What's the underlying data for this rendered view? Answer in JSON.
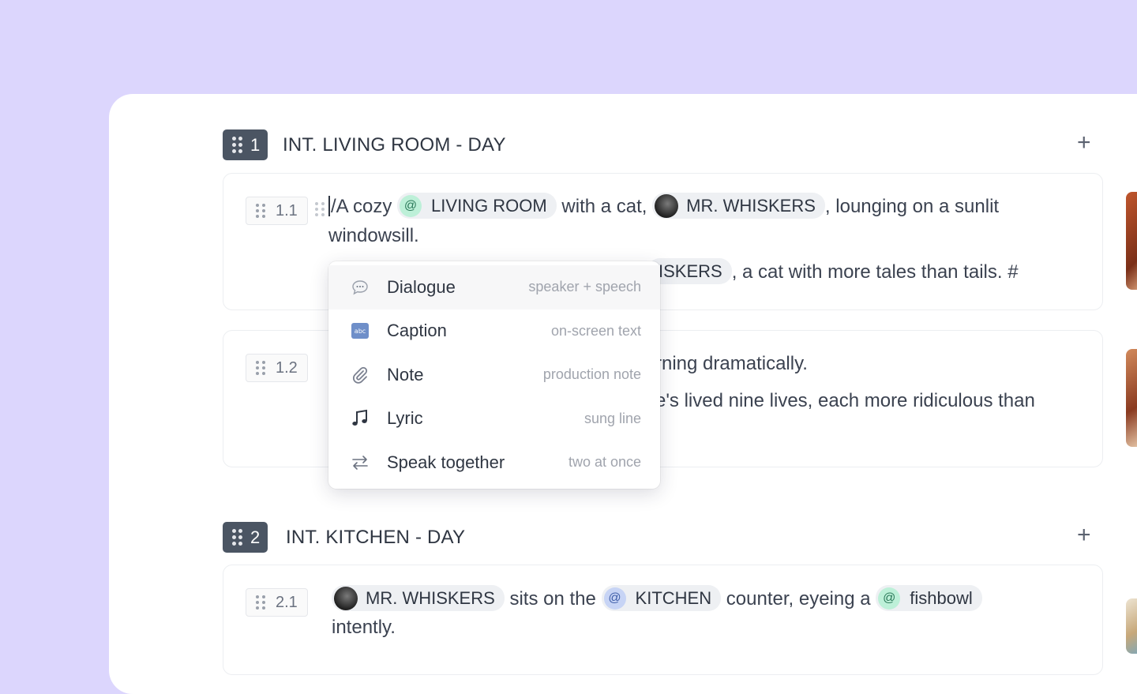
{
  "colors": {
    "background": "#dcd6fd",
    "card": "#ffffff",
    "badge": "#4b5563",
    "location_chip": "#bdf0d8",
    "prop_chip": "#c7d4f5"
  },
  "scenes": [
    {
      "number": "1",
      "title": "INT. LIVING ROOM - DAY",
      "add_icon": "+",
      "shots": [
        {
          "number": "1.1",
          "line1": {
            "slash": "/",
            "t1": "A cozy",
            "chip1": "LIVING ROOM",
            "t2": "with a cat,",
            "chip2": "MR. WHISKERS",
            "t3": ", lounging on a sunlit"
          },
          "line2": "windowsill.",
          "line3": {
            "chip_tail": "ISKERS",
            "t": ", a cat with more tales than tails. #"
          }
        },
        {
          "number": "1.2",
          "line1": "rning dramatically.",
          "line2": "e's lived nine lives, each more ridiculous than"
        }
      ]
    },
    {
      "number": "2",
      "title": "INT. KITCHEN - DAY",
      "add_icon": "+",
      "shots": [
        {
          "number": "2.1",
          "line1": {
            "chip1": "MR. WHISKERS",
            "t1": "sits on the",
            "chip2": "KITCHEN",
            "t2": "counter, eyeing a",
            "chip3": "fishbowl"
          },
          "line2": "intently."
        }
      ]
    }
  ],
  "menu": [
    {
      "icon": "speech-bubble-icon",
      "label": "Dialogue",
      "hint": "speaker + speech"
    },
    {
      "icon": "abc-icon",
      "label": "Caption",
      "hint": "on-screen text"
    },
    {
      "icon": "paperclip-icon",
      "label": "Note",
      "hint": "production note"
    },
    {
      "icon": "music-note-icon",
      "label": "Lyric",
      "hint": "sung line"
    },
    {
      "icon": "swap-arrows-icon",
      "label": "Speak together",
      "hint": "two at once"
    }
  ]
}
